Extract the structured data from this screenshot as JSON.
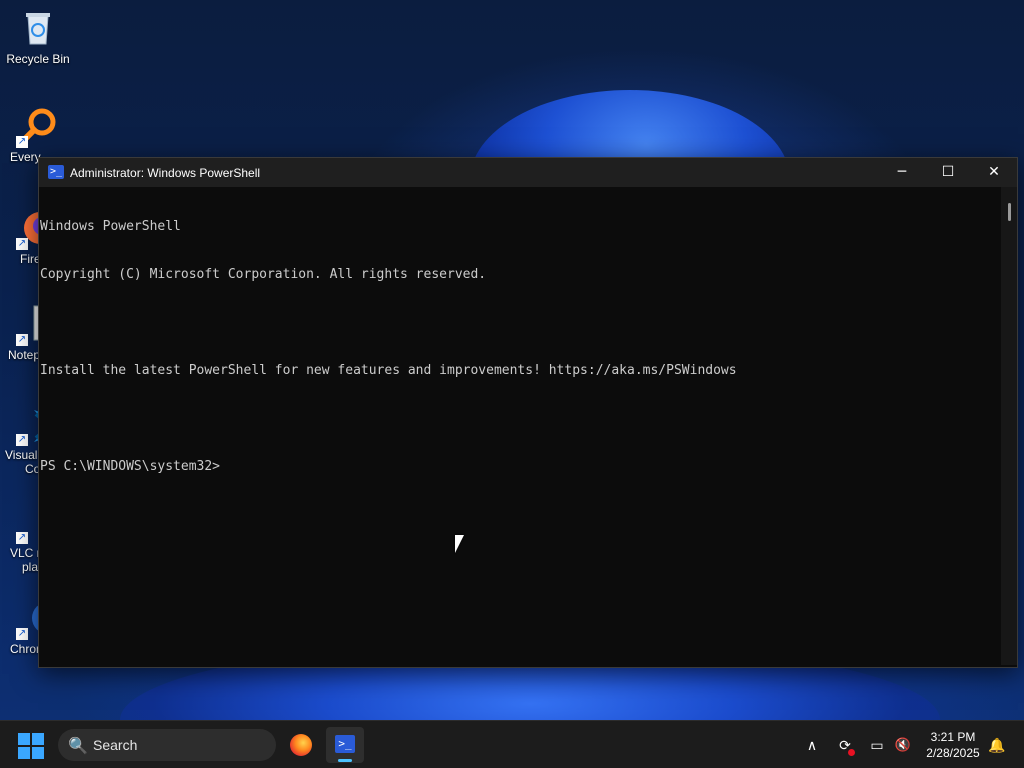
{
  "desktop": {
    "icons": [
      {
        "label": "Recycle Bin",
        "icon": "recycle-bin-icon"
      },
      {
        "label": "Every",
        "icon": "everything-search-icon"
      },
      {
        "label": "Fire",
        "icon": "firefox-icon"
      },
      {
        "label": "Notep",
        "icon": "notepad-plus-plus-icon"
      },
      {
        "label": "Visual",
        "label2": "Co",
        "icon": "vscode-icon"
      },
      {
        "label": "VLC m",
        "label2": "pla",
        "icon": "vlc-icon"
      },
      {
        "label": "Chrom",
        "icon": "chrome-icon"
      }
    ]
  },
  "window": {
    "title": "Administrator: Windows PowerShell",
    "minimize": "─",
    "maximize": "☐",
    "close": "✕",
    "console_lines": [
      "Windows PowerShell",
      "Copyright (C) Microsoft Corporation. All rights reserved.",
      "",
      "Install the latest PowerShell for new features and improvements! https://aka.ms/PSWindows",
      "",
      "PS C:\\WINDOWS\\system32>"
    ]
  },
  "taskbar": {
    "search_label": "Search",
    "search_icon": "🔍",
    "ps_glyph": ">_",
    "tray_chevron": "∧",
    "tray_sync": "⟳",
    "tray_network": "▭",
    "tray_volume": "🔇",
    "notification": "🔔",
    "time": "3:21 PM",
    "date": "2/28/2025"
  },
  "colors": {
    "console_bg": "#0c0c0c",
    "console_text": "#cccccc",
    "taskbar_bg": "#1c1c1c",
    "accent": "#4cc2ff"
  }
}
